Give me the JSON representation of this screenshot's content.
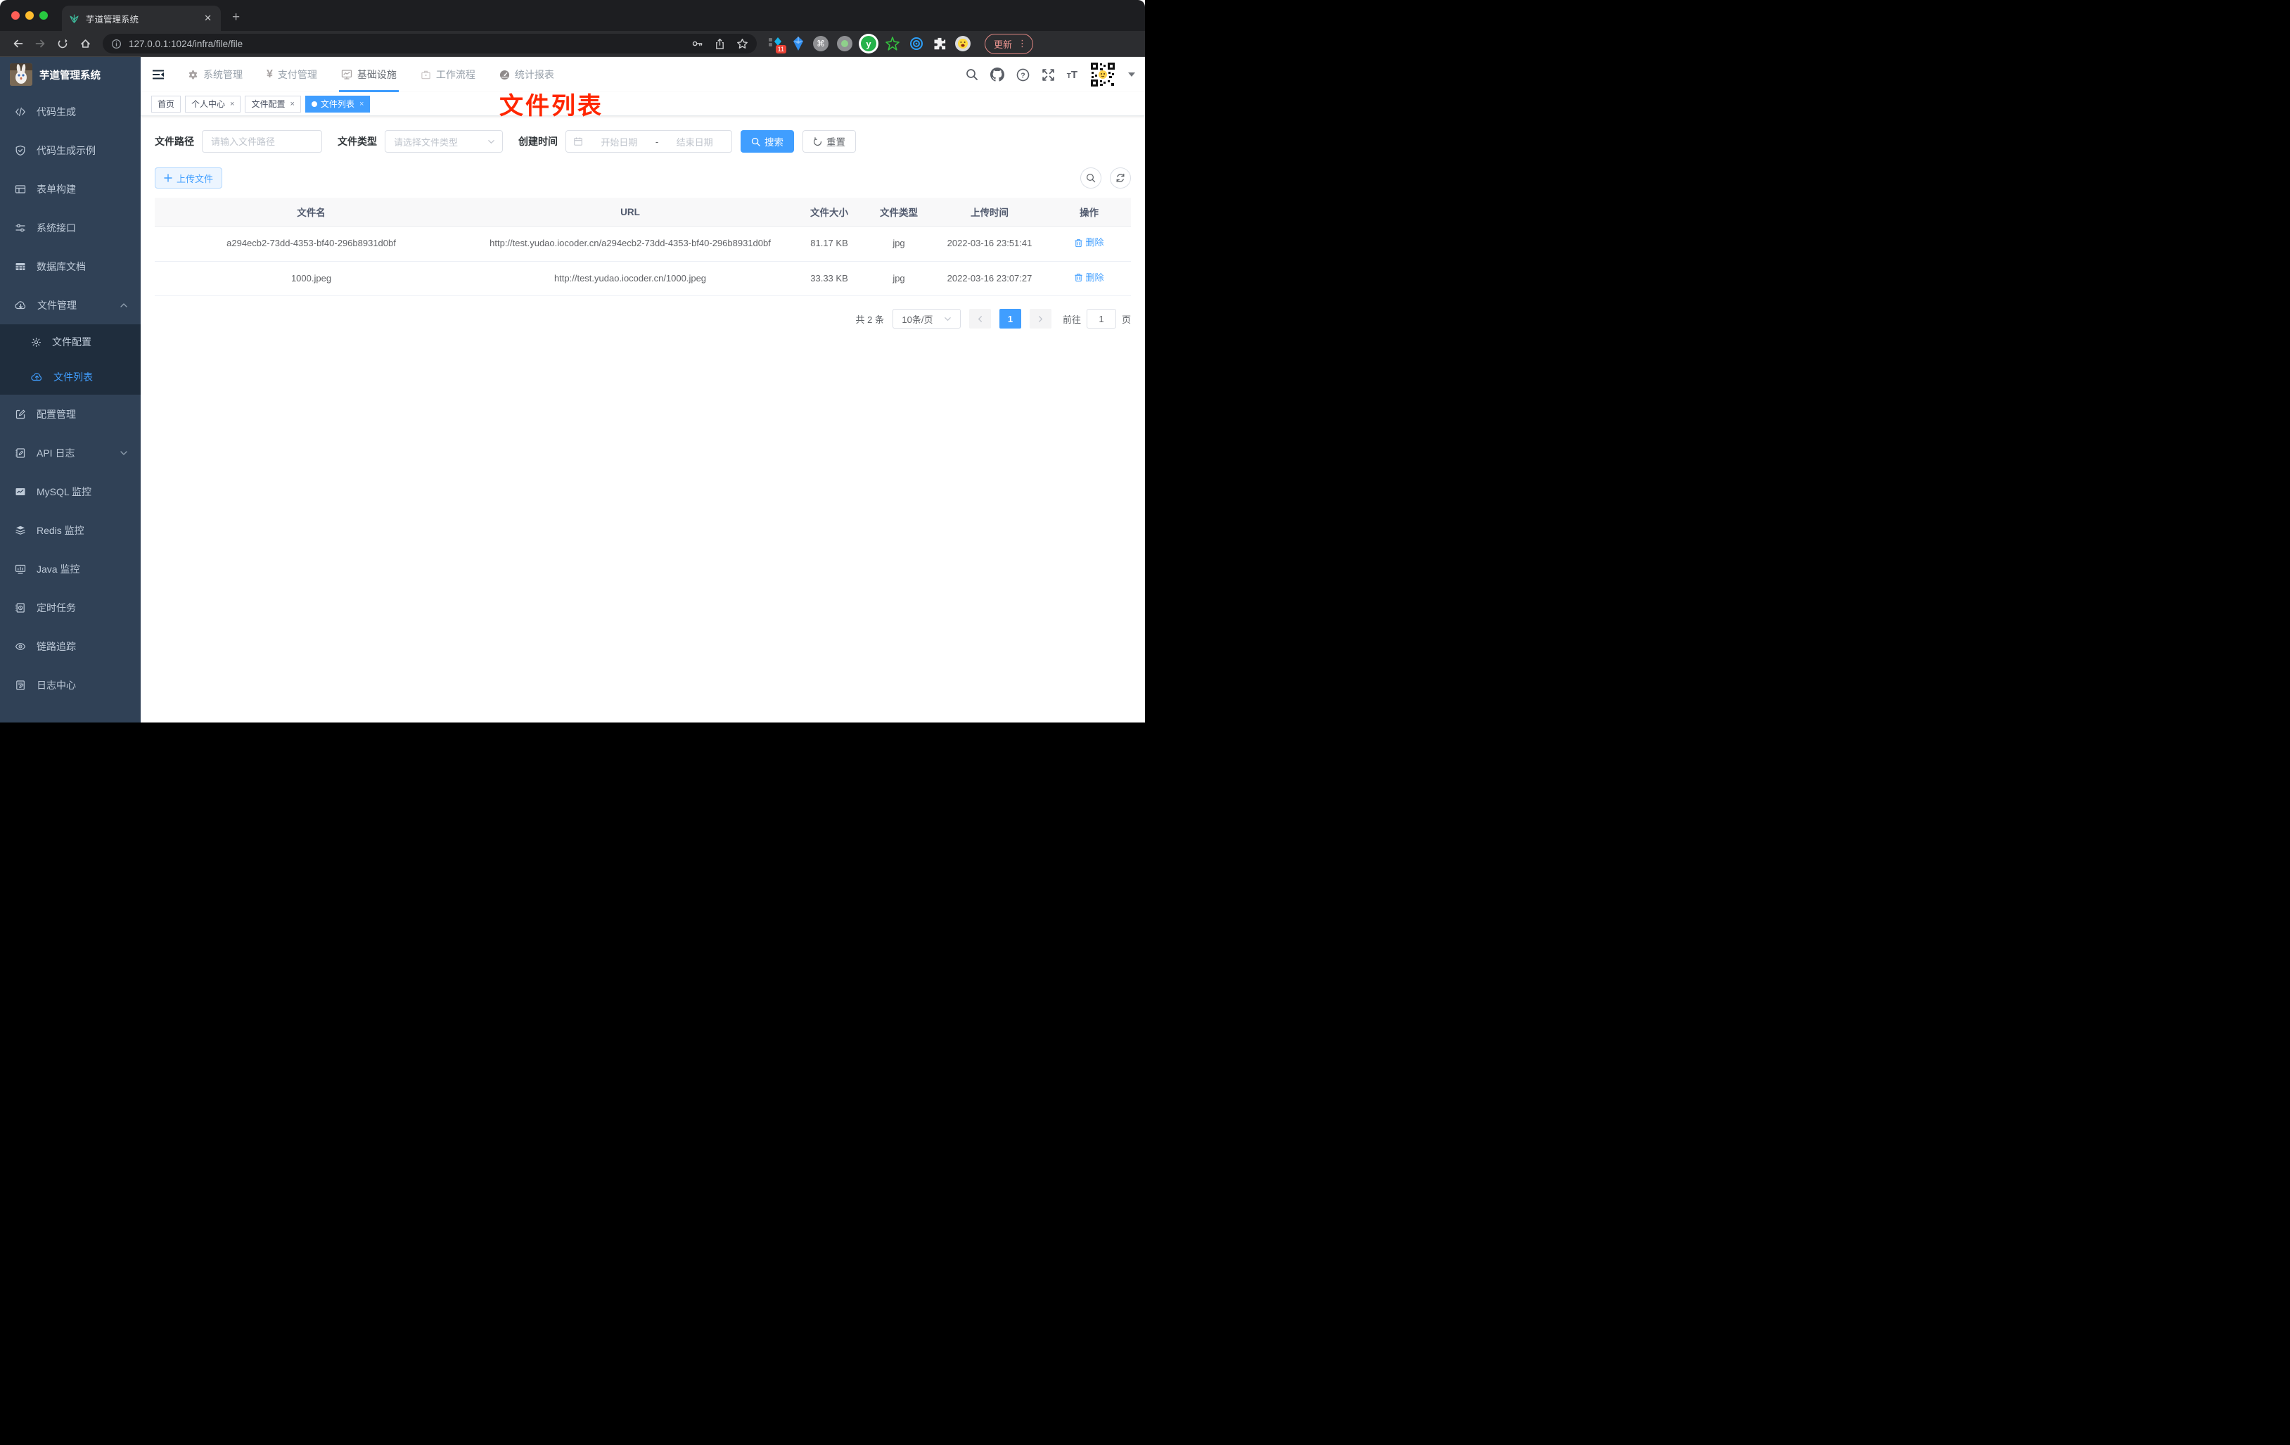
{
  "browser": {
    "tab_title": "芋道管理系统",
    "url": "127.0.0.1:1024/infra/file/file",
    "update_label": "更新",
    "extension_badge": "11"
  },
  "header": {
    "logo_title": "芋道管理系统",
    "menu": [
      {
        "label": "系统管理"
      },
      {
        "label": "支付管理"
      },
      {
        "label": "基础设施"
      },
      {
        "label": "工作流程"
      },
      {
        "label": "统计报表"
      }
    ]
  },
  "sidebar": {
    "items": [
      {
        "label": "代码生成"
      },
      {
        "label": "代码生成示例"
      },
      {
        "label": "表单构建"
      },
      {
        "label": "系统接口"
      },
      {
        "label": "数据库文档"
      },
      {
        "label": "文件管理"
      },
      {
        "label": "文件配置"
      },
      {
        "label": "文件列表"
      },
      {
        "label": "配置管理"
      },
      {
        "label": "API 日志"
      },
      {
        "label": "MySQL 监控"
      },
      {
        "label": "Redis 监控"
      },
      {
        "label": "Java 监控"
      },
      {
        "label": "定时任务"
      },
      {
        "label": "链路追踪"
      },
      {
        "label": "日志中心"
      }
    ]
  },
  "tags": [
    {
      "label": "首页"
    },
    {
      "label": "个人中心"
    },
    {
      "label": "文件配置"
    },
    {
      "label": "文件列表"
    }
  ],
  "annotation": {
    "text": "文件列表",
    "color": "#ff2600"
  },
  "filter": {
    "path_label": "文件路径",
    "path_placeholder": "请输入文件路径",
    "type_label": "文件类型",
    "type_placeholder": "请选择文件类型",
    "date_label": "创建时间",
    "date_start_placeholder": "开始日期",
    "date_separator": "-",
    "date_end_placeholder": "结束日期",
    "search_label": "搜索",
    "reset_label": "重置"
  },
  "toolbar": {
    "upload_label": "上传文件"
  },
  "table": {
    "headers": [
      "文件名",
      "URL",
      "文件大小",
      "文件类型",
      "上传时间",
      "操作"
    ],
    "rows": [
      {
        "name": "a294ecb2-73dd-4353-bf40-296b8931d0bf",
        "url": "http://test.yudao.iocoder.cn/a294ecb2-73dd-4353-bf40-296b8931d0bf",
        "size": "81.17 KB",
        "type": "jpg",
        "time": "2022-03-16 23:51:41",
        "action": "删除"
      },
      {
        "name": "1000.jpeg",
        "url": "http://test.yudao.iocoder.cn/1000.jpeg",
        "size": "33.33 KB",
        "type": "jpg",
        "time": "2022-03-16 23:07:27",
        "action": "删除"
      }
    ]
  },
  "pagination": {
    "total": "共 2 条",
    "page_size": "10条/页",
    "current_page": "1",
    "goto_label": "前往",
    "goto_value": "1",
    "goto_unit": "页"
  },
  "colors": {
    "accent": "#409eff",
    "sidebar_bg": "#304156",
    "submenu_bg": "#1f2d3d",
    "annotation": "#ff2600"
  }
}
